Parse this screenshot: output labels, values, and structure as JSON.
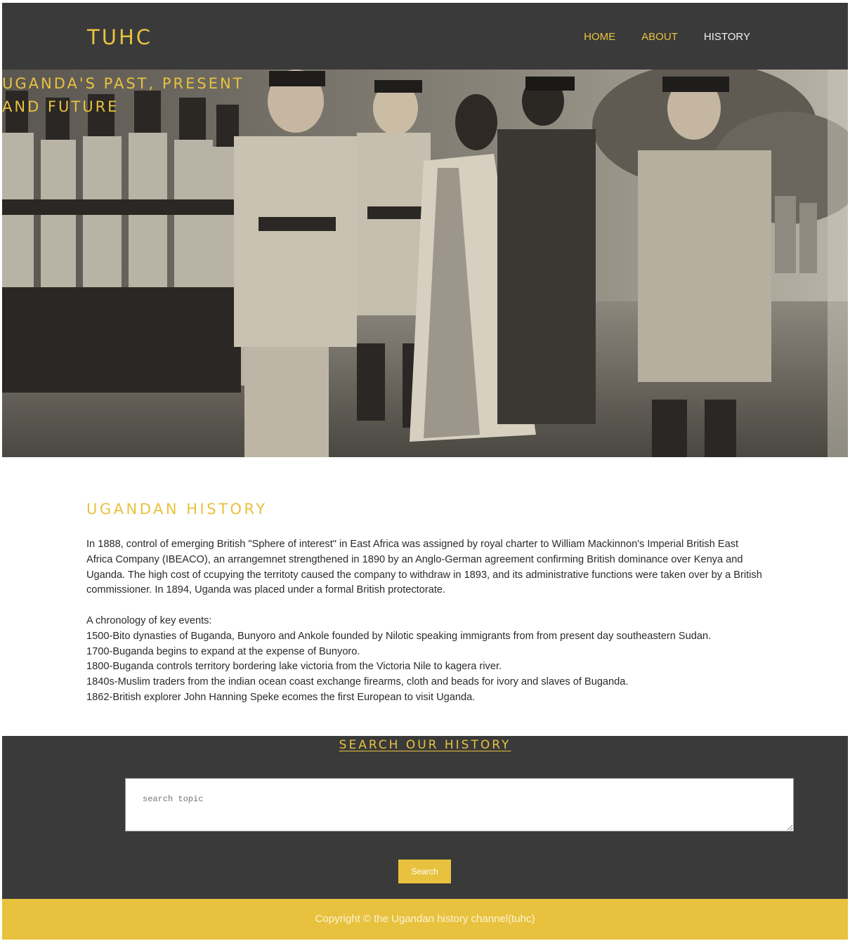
{
  "header": {
    "logo": "TUHC",
    "nav": [
      {
        "label": "HOME"
      },
      {
        "label": "ABOUT"
      },
      {
        "label": "HISTORY"
      }
    ]
  },
  "hero": {
    "title": "UGANDA'S PAST, PRESENT AND FUTURE"
  },
  "history": {
    "heading": "UGANDAN HISTORY",
    "intro": "In 1888, control of emerging British \"Sphere of interest\" in East Africa was assigned by royal charter to William Mackinnon's Imperial British East Africa Company (IBEACO), an arrangemnet strengthened in 1890 by an Anglo-German agreement confirming British dominance over Kenya and Uganda. The high cost of ccupying the territoty caused the company to withdraw in 1893, and its administrative functions were taken over by a British commissioner. In 1894, Uganda was placed under a formal British protectorate.",
    "chronology_label": "A chronology of key events:",
    "events": [
      "1500-Bito dynasties of Buganda, Bunyoro and Ankole founded by Nilotic speaking immigrants from from present day southeastern Sudan.",
      "1700-Buganda begins to expand at the expense of Bunyoro.",
      "1800-Buganda controls territory bordering lake victoria from the Victoria Nile to kagera river.",
      "1840s-Muslim traders from the indian ocean coast exchange firearms, cloth and beads for ivory and slaves of Buganda.",
      "1862-British explorer John Hanning Speke ecomes the first European to visit Uganda."
    ]
  },
  "search": {
    "title": "SEARCH OUR HISTORY",
    "placeholder": "search topic",
    "button": "Search"
  },
  "footer": {
    "copyright": "Copyright © the Ugandan history channel(tuhc)"
  },
  "colors": {
    "accent": "#e8c23e",
    "dark": "#3a3a3a"
  }
}
